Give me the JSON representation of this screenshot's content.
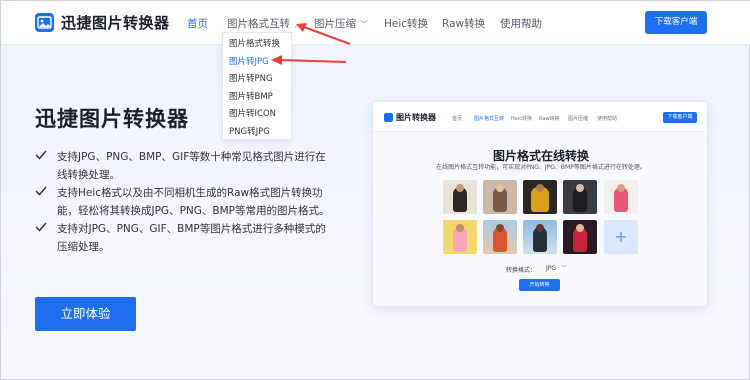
{
  "header": {
    "logo_text": "迅捷图片转换器",
    "nav": [
      {
        "label": "首页",
        "active": true
      },
      {
        "label": "图片格式互转",
        "has_dropdown": true
      },
      {
        "label": "图片压缩",
        "has_dropdown": true
      },
      {
        "label": "Heic转换"
      },
      {
        "label": "Raw转换"
      },
      {
        "label": "使用帮助"
      }
    ],
    "download_label": "下载客户端"
  },
  "dropdown": {
    "items": [
      "图片格式转换",
      "图片转JPG",
      "图片转PNG",
      "图片转BMP",
      "图片转ICON",
      "PNG转JPG"
    ],
    "highlighted_index": 1
  },
  "hero": {
    "title": "迅捷图片转换器",
    "features": [
      "支持JPG、PNG、BMP、GIF等数十种常见格式图片进行在线转换处理。",
      "支持Heic格式以及由不同相机生成的Raw格式图片转换功能，轻松将其转换成JPG、PNG、BMP等常用的图片格式。",
      "支持对JPG、PNG、GIF、BMP等图片格式进行多种模式的压缩处理。"
    ],
    "cta_label": "立即体验"
  },
  "mockup": {
    "logo_text": "图片转换器",
    "nav": [
      "首页",
      "图片格式互转",
      "Heic转换",
      "Raw转换",
      "图片压缩",
      "使用帮助"
    ],
    "active_nav_index": 1,
    "download_label": "下载客户端",
    "title": "图片格式在线转换",
    "subtitle": "在线图片格式互转功能，可实现对PNG、JPG、BMP等图片格式进行在转处理。",
    "format_label": "转换格式：",
    "format_value": "JPG",
    "start_label": "开始转换"
  },
  "colors": {
    "accent": "#1e6ff0",
    "annotation_arrow": "#e8403a"
  }
}
